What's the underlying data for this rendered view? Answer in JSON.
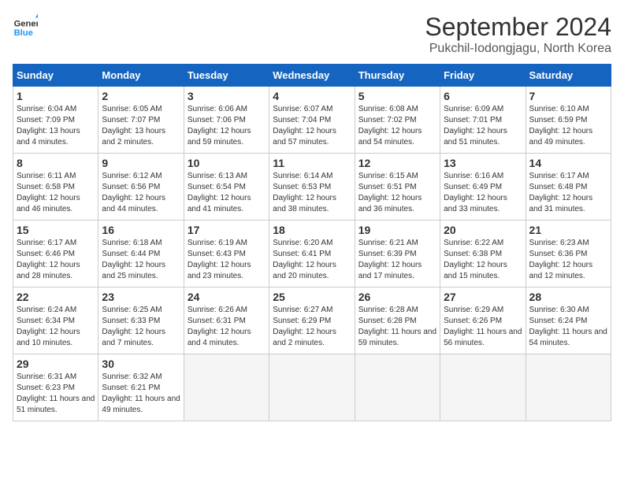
{
  "header": {
    "logo_line1": "General",
    "logo_line2": "Blue",
    "month_title": "September 2024",
    "location": "Pukchil-Iodongjagu, North Korea"
  },
  "weekdays": [
    "Sunday",
    "Monday",
    "Tuesday",
    "Wednesday",
    "Thursday",
    "Friday",
    "Saturday"
  ],
  "weeks": [
    [
      {
        "num": "1",
        "sunrise": "6:04 AM",
        "sunset": "7:09 PM",
        "daylight": "13 hours and 4 minutes."
      },
      {
        "num": "2",
        "sunrise": "6:05 AM",
        "sunset": "7:07 PM",
        "daylight": "13 hours and 2 minutes."
      },
      {
        "num": "3",
        "sunrise": "6:06 AM",
        "sunset": "7:06 PM",
        "daylight": "12 hours and 59 minutes."
      },
      {
        "num": "4",
        "sunrise": "6:07 AM",
        "sunset": "7:04 PM",
        "daylight": "12 hours and 57 minutes."
      },
      {
        "num": "5",
        "sunrise": "6:08 AM",
        "sunset": "7:02 PM",
        "daylight": "12 hours and 54 minutes."
      },
      {
        "num": "6",
        "sunrise": "6:09 AM",
        "sunset": "7:01 PM",
        "daylight": "12 hours and 51 minutes."
      },
      {
        "num": "7",
        "sunrise": "6:10 AM",
        "sunset": "6:59 PM",
        "daylight": "12 hours and 49 minutes."
      }
    ],
    [
      {
        "num": "8",
        "sunrise": "6:11 AM",
        "sunset": "6:58 PM",
        "daylight": "12 hours and 46 minutes."
      },
      {
        "num": "9",
        "sunrise": "6:12 AM",
        "sunset": "6:56 PM",
        "daylight": "12 hours and 44 minutes."
      },
      {
        "num": "10",
        "sunrise": "6:13 AM",
        "sunset": "6:54 PM",
        "daylight": "12 hours and 41 minutes."
      },
      {
        "num": "11",
        "sunrise": "6:14 AM",
        "sunset": "6:53 PM",
        "daylight": "12 hours and 38 minutes."
      },
      {
        "num": "12",
        "sunrise": "6:15 AM",
        "sunset": "6:51 PM",
        "daylight": "12 hours and 36 minutes."
      },
      {
        "num": "13",
        "sunrise": "6:16 AM",
        "sunset": "6:49 PM",
        "daylight": "12 hours and 33 minutes."
      },
      {
        "num": "14",
        "sunrise": "6:17 AM",
        "sunset": "6:48 PM",
        "daylight": "12 hours and 31 minutes."
      }
    ],
    [
      {
        "num": "15",
        "sunrise": "6:17 AM",
        "sunset": "6:46 PM",
        "daylight": "12 hours and 28 minutes."
      },
      {
        "num": "16",
        "sunrise": "6:18 AM",
        "sunset": "6:44 PM",
        "daylight": "12 hours and 25 minutes."
      },
      {
        "num": "17",
        "sunrise": "6:19 AM",
        "sunset": "6:43 PM",
        "daylight": "12 hours and 23 minutes."
      },
      {
        "num": "18",
        "sunrise": "6:20 AM",
        "sunset": "6:41 PM",
        "daylight": "12 hours and 20 minutes."
      },
      {
        "num": "19",
        "sunrise": "6:21 AM",
        "sunset": "6:39 PM",
        "daylight": "12 hours and 17 minutes."
      },
      {
        "num": "20",
        "sunrise": "6:22 AM",
        "sunset": "6:38 PM",
        "daylight": "12 hours and 15 minutes."
      },
      {
        "num": "21",
        "sunrise": "6:23 AM",
        "sunset": "6:36 PM",
        "daylight": "12 hours and 12 minutes."
      }
    ],
    [
      {
        "num": "22",
        "sunrise": "6:24 AM",
        "sunset": "6:34 PM",
        "daylight": "12 hours and 10 minutes."
      },
      {
        "num": "23",
        "sunrise": "6:25 AM",
        "sunset": "6:33 PM",
        "daylight": "12 hours and 7 minutes."
      },
      {
        "num": "24",
        "sunrise": "6:26 AM",
        "sunset": "6:31 PM",
        "daylight": "12 hours and 4 minutes."
      },
      {
        "num": "25",
        "sunrise": "6:27 AM",
        "sunset": "6:29 PM",
        "daylight": "12 hours and 2 minutes."
      },
      {
        "num": "26",
        "sunrise": "6:28 AM",
        "sunset": "6:28 PM",
        "daylight": "11 hours and 59 minutes."
      },
      {
        "num": "27",
        "sunrise": "6:29 AM",
        "sunset": "6:26 PM",
        "daylight": "11 hours and 56 minutes."
      },
      {
        "num": "28",
        "sunrise": "6:30 AM",
        "sunset": "6:24 PM",
        "daylight": "11 hours and 54 minutes."
      }
    ],
    [
      {
        "num": "29",
        "sunrise": "6:31 AM",
        "sunset": "6:23 PM",
        "daylight": "11 hours and 51 minutes."
      },
      {
        "num": "30",
        "sunrise": "6:32 AM",
        "sunset": "6:21 PM",
        "daylight": "11 hours and 49 minutes."
      },
      null,
      null,
      null,
      null,
      null
    ]
  ]
}
